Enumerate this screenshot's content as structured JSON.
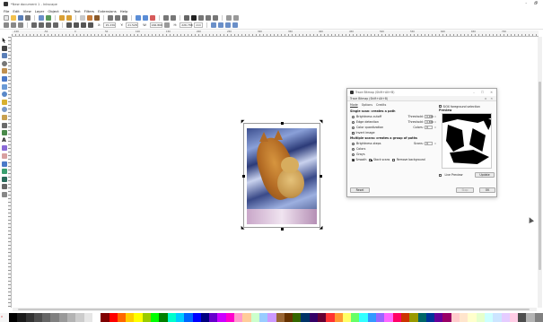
{
  "window": {
    "title": "*New document 1 - Inkscape",
    "controls": [
      "–",
      "🗗"
    ]
  },
  "menu": [
    "File",
    "Edit",
    "View",
    "Layer",
    "Object",
    "Path",
    "Text",
    "Filters",
    "Extensions",
    "Help"
  ],
  "controls": {
    "x_label": "X:",
    "x_value": "15.239",
    "y_label": "Y:",
    "y_value": "21.528",
    "w_label": "W:",
    "w_value": "166.866",
    "h_label": "H:",
    "h_value": "226.788",
    "unit": "mm"
  },
  "ruler_ticks": [
    "-100",
    "-50",
    "0",
    "50",
    "100",
    "150",
    "200",
    "250",
    "300",
    "350",
    "400",
    "450",
    "500",
    "550",
    "600",
    "650",
    "700"
  ],
  "dialog": {
    "window_title": "Trace Bitmap (Shift+Alt+B)",
    "panel_title": "Trace Bitmap (Shift+Alt+B)",
    "tabs": [
      "Mode",
      "Options",
      "Credits"
    ],
    "single_section": "Single scan: creates a path",
    "brightness_cutoff": "Brightness cutoff",
    "threshold_label": "Threshold:",
    "brightness_threshold": "0.450",
    "edge_detection": "Edge detection",
    "edge_threshold": "0.650",
    "color_quantization": "Color quantization",
    "colors_label": "Colors:",
    "colors_value": "8",
    "invert_image": "Invert image",
    "multiple_section": "Multiple scans: creates a group of paths",
    "brightness_steps": "Brightness steps",
    "scans_label": "Scans:",
    "scans_value": "8",
    "colors": "Colors",
    "grays": "Grays",
    "smooth": "Smooth",
    "stack_scans": "Stack scans",
    "remove_background": "Remove background",
    "siox": "SIOX foreground selection",
    "preview_label": "Preview",
    "live_preview": "Live Preview",
    "update": "Update",
    "reset": "Reset",
    "stop": "Stop",
    "ok": "OK"
  },
  "palette": {
    "none_tag": "X",
    "colors": [
      "#000000",
      "#1a1a1a",
      "#333333",
      "#4d4d4d",
      "#666666",
      "#808080",
      "#999999",
      "#b3b3b3",
      "#cccccc",
      "#e6e6e6",
      "#ffffff",
      "#800000",
      "#ff0000",
      "#ff6600",
      "#ffcc00",
      "#ffff00",
      "#99cc00",
      "#00ff00",
      "#008000",
      "#00ffcc",
      "#00ccff",
      "#0066ff",
      "#0000ff",
      "#000080",
      "#6600cc",
      "#cc00ff",
      "#ff00cc",
      "#ff99cc",
      "#ffcc99",
      "#ccffcc",
      "#99ccff",
      "#cc99ff",
      "#996633",
      "#663300",
      "#336600",
      "#003366",
      "#330066",
      "#660033",
      "#ff3333",
      "#ff9933",
      "#ffff66",
      "#66ff66",
      "#33ffff",
      "#3399ff",
      "#9966ff",
      "#ff66ff",
      "#ff0066",
      "#cc3300",
      "#999900",
      "#006666",
      "#003399",
      "#660099",
      "#990066",
      "#ffcccc",
      "#ffe5cc",
      "#ffffcc",
      "#e5ffcc",
      "#ccffff",
      "#cce5ff",
      "#e5ccff",
      "#ffcce5",
      "#4d4d4d",
      "#b3b3b3",
      "#808080"
    ]
  }
}
